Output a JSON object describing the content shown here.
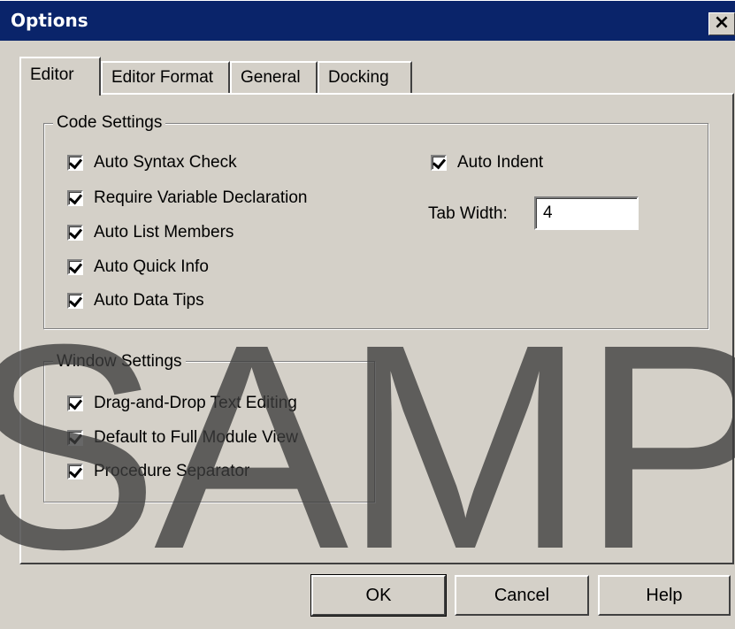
{
  "window": {
    "title": "Options",
    "close_label": "×"
  },
  "tabs": [
    {
      "label": "Editor",
      "active": true
    },
    {
      "label": "Editor Format",
      "active": false
    },
    {
      "label": "General",
      "active": false
    },
    {
      "label": "Docking",
      "active": false
    }
  ],
  "code_settings": {
    "label": "Code Settings",
    "checkboxes": [
      {
        "label": "Auto Syntax Check",
        "checked": true
      },
      {
        "label": "Require Variable Declaration",
        "checked": true
      },
      {
        "label": "Auto List Members",
        "checked": true
      },
      {
        "label": "Auto Quick Info",
        "checked": true
      },
      {
        "label": "Auto Data Tips",
        "checked": true
      }
    ],
    "auto_indent": {
      "label": "Auto Indent",
      "checked": true
    },
    "tab_width": {
      "label": "Tab Width:",
      "value": "4"
    }
  },
  "window_settings": {
    "label": "Window Settings",
    "checkboxes": [
      {
        "label": "Drag-and-Drop Text Editing",
        "checked": true
      },
      {
        "label": "Default to Full Module View",
        "checked": true
      },
      {
        "label": "Procedure Separator",
        "checked": true
      }
    ]
  },
  "buttons": {
    "ok": "OK",
    "cancel": "Cancel",
    "help": "Help"
  },
  "watermark": "SAMP"
}
